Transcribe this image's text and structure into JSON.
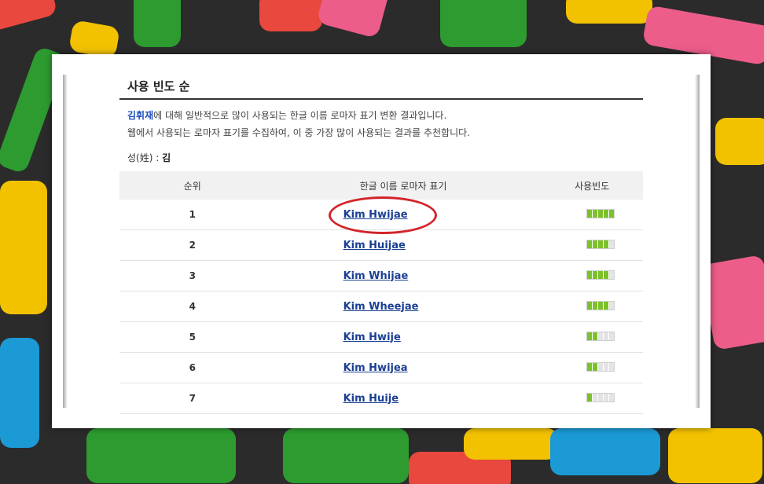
{
  "colors": {
    "link": "#1a3f93",
    "highlight": "#1a4dbd",
    "bar_on": "#7cc12b",
    "bar_off": "#e4e4e4",
    "annotation": "#d3242a"
  },
  "section_title": "사용 빈도 순",
  "description": {
    "highlight_name": "김휘재",
    "line1_rest": "에 대해 일반적으로 많이 사용되는 한글 이름 로마자 표기 변환 결과입니다.",
    "line2": "웹에서 사용되는 로마자 표기를 수집하여, 이 중 가장 많이 사용되는 결과를 추천합니다."
  },
  "surname": {
    "label": "성(姓) :",
    "value": "김"
  },
  "table": {
    "headers": [
      "순위",
      "한글 이름 로마자 표기",
      "사용빈도"
    ],
    "rows": [
      {
        "rank": "1",
        "name": "Kim Hwijae",
        "freq": 5
      },
      {
        "rank": "2",
        "name": "Kim Huijae",
        "freq": 4
      },
      {
        "rank": "3",
        "name": "Kim Whijae",
        "freq": 4
      },
      {
        "rank": "4",
        "name": "Kim Wheejae",
        "freq": 4
      },
      {
        "rank": "5",
        "name": "Kim Hwije",
        "freq": 2
      },
      {
        "rank": "6",
        "name": "Kim Hwijea",
        "freq": 2
      },
      {
        "rank": "7",
        "name": "Kim Huije",
        "freq": 1
      }
    ],
    "freq_max": 5
  }
}
